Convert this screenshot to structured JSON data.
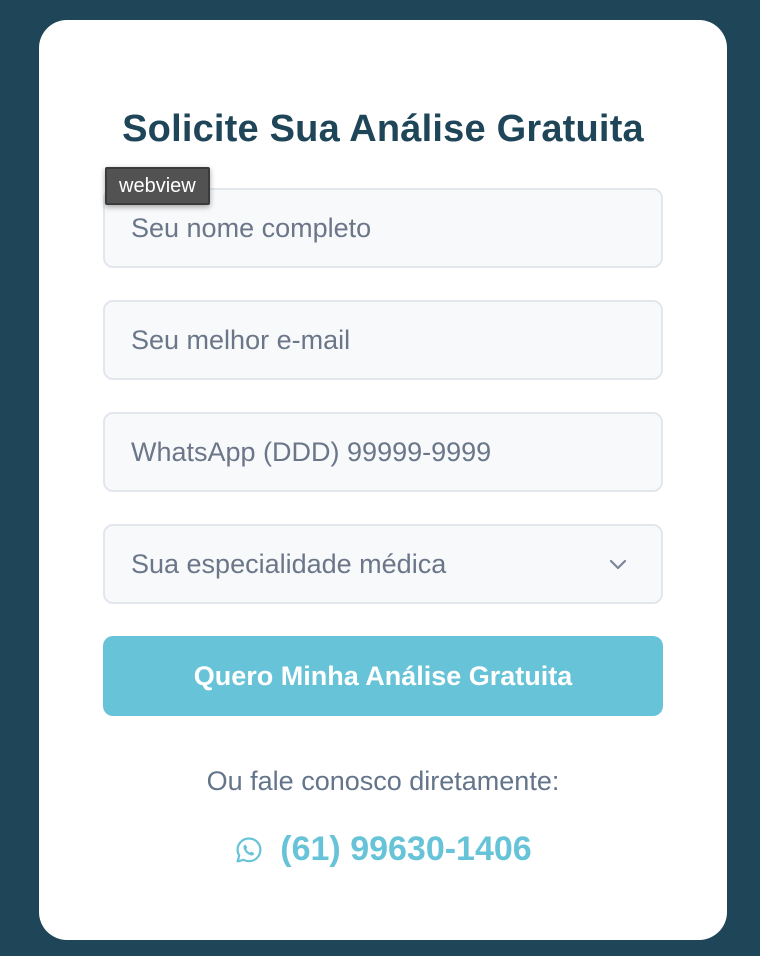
{
  "form": {
    "title": "Solicite Sua Análise Gratuita",
    "tooltip": "webview",
    "name_placeholder": "Seu nome completo",
    "email_placeholder": "Seu melhor e-mail",
    "whatsapp_placeholder": "WhatsApp (DDD) 99999-9999",
    "specialty_selected": "Sua especialidade médica",
    "submit_label": "Quero Minha Análise Gratuita",
    "contact_text": "Ou fale conosco diretamente:",
    "phone": "(61) 99630-1406",
    "phone_icon": "whatsapp-icon"
  },
  "colors": {
    "background": "#1f4558",
    "card": "#ffffff",
    "title": "#1f4558",
    "accent": "#67c3d7",
    "muted_text": "#64748b",
    "field_bg": "#f7f9fb",
    "field_border": "#e2e7ee"
  }
}
